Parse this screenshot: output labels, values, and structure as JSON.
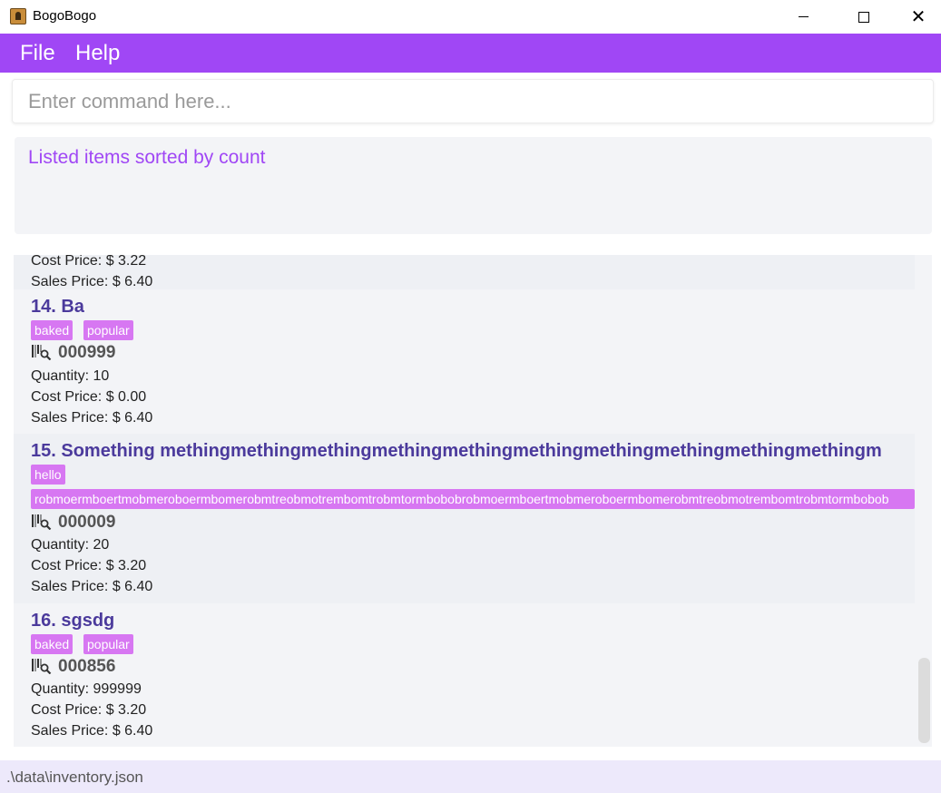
{
  "window": {
    "title": "BogoBogo",
    "minimize": "",
    "maximize": "",
    "close": "✕"
  },
  "menu": {
    "file": "File",
    "help": "Help"
  },
  "command": {
    "placeholder": "Enter command here...",
    "value": ""
  },
  "result": {
    "message": "Listed items sorted by count"
  },
  "items": [
    {
      "partial": true,
      "cost": "Cost Price: $ 3.22",
      "sales": "Sales Price: $ 6.40"
    },
    {
      "title": "14.  Ba",
      "tags": [
        "baked",
        "popular"
      ],
      "barcode": "000999",
      "quantity": "Quantity: 10",
      "cost": "Cost Price: $ 0.00",
      "sales": "Sales Price: $ 6.40"
    },
    {
      "title": "15.  Something methingmethingmethingmethingmethingmethingmethingmethingmethingmethingm",
      "tags": [
        "hello",
        "robmoermboertmobmeroboermbomerobmtreobmotrembomtrobmtormbobobrobmoermboertmobmeroboermbomerobmtreobmotrembomtrobmtormbobob"
      ],
      "barcode": "000009",
      "quantity": "Quantity: 20",
      "cost": "Cost Price: $ 3.20",
      "sales": "Sales Price: $ 6.40"
    },
    {
      "title": "16.  sgsdg",
      "tags": [
        "baked",
        "popular"
      ],
      "barcode": "000856",
      "quantity": "Quantity: 999999",
      "cost": "Cost Price: $ 3.20",
      "sales": "Sales Price: $ 6.40"
    }
  ],
  "status": {
    "path": ".\\data\\inventory.json"
  },
  "colors": {
    "accent": "#a047f5",
    "tag": "#d777f2",
    "title": "#4b3a9c"
  }
}
